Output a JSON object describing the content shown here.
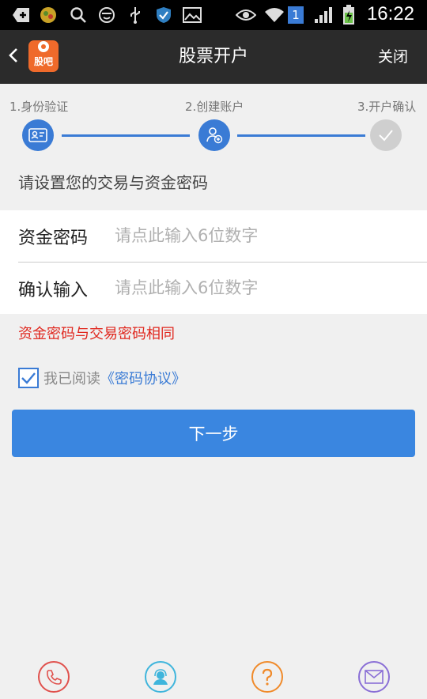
{
  "status_bar": {
    "time": "16:22",
    "sim_badge": "1",
    "icons": [
      "add-icon",
      "app-icon",
      "search-icon",
      "face-icon",
      "usb-icon",
      "shield-icon",
      "image-icon",
      "eye-icon",
      "wifi-icon",
      "sim-icon",
      "signal-icon",
      "battery-icon"
    ]
  },
  "header": {
    "back_icon": "chevron-left-icon",
    "logo_text": "股吧",
    "title": "股票开户",
    "close_label": "关闭"
  },
  "steps": [
    {
      "label": "1.身份验证",
      "icon": "id-card-icon",
      "state": "done"
    },
    {
      "label": "2.创建账户",
      "icon": "add-user-icon",
      "state": "active"
    },
    {
      "label": "3.开户确认",
      "icon": "check-icon",
      "state": "pending"
    }
  ],
  "section_title": "请设置您的交易与资金密码",
  "form": {
    "fund_password": {
      "label": "资金密码",
      "placeholder": "请点此输入6位数字",
      "value": ""
    },
    "confirm_password": {
      "label": "确认输入",
      "placeholder": "请点此输入6位数字",
      "value": ""
    }
  },
  "warning": "资金密码与交易密码相同",
  "agreement": {
    "checked": true,
    "prefix": "我已阅读",
    "link": "《密码协议》"
  },
  "next_button": "下一步",
  "bottom_bar": [
    {
      "icon": "phone-icon",
      "color": "#e0514d"
    },
    {
      "icon": "customer-service-icon",
      "color": "#3fb5dc"
    },
    {
      "icon": "question-icon",
      "color": "#f08a2a"
    },
    {
      "icon": "mail-icon",
      "color": "#8a6fd6"
    }
  ],
  "colors": {
    "accent": "#3a86e0",
    "header_bg": "#2b2b2b",
    "warning": "#e0281f",
    "logo": "#ef6a2b"
  }
}
